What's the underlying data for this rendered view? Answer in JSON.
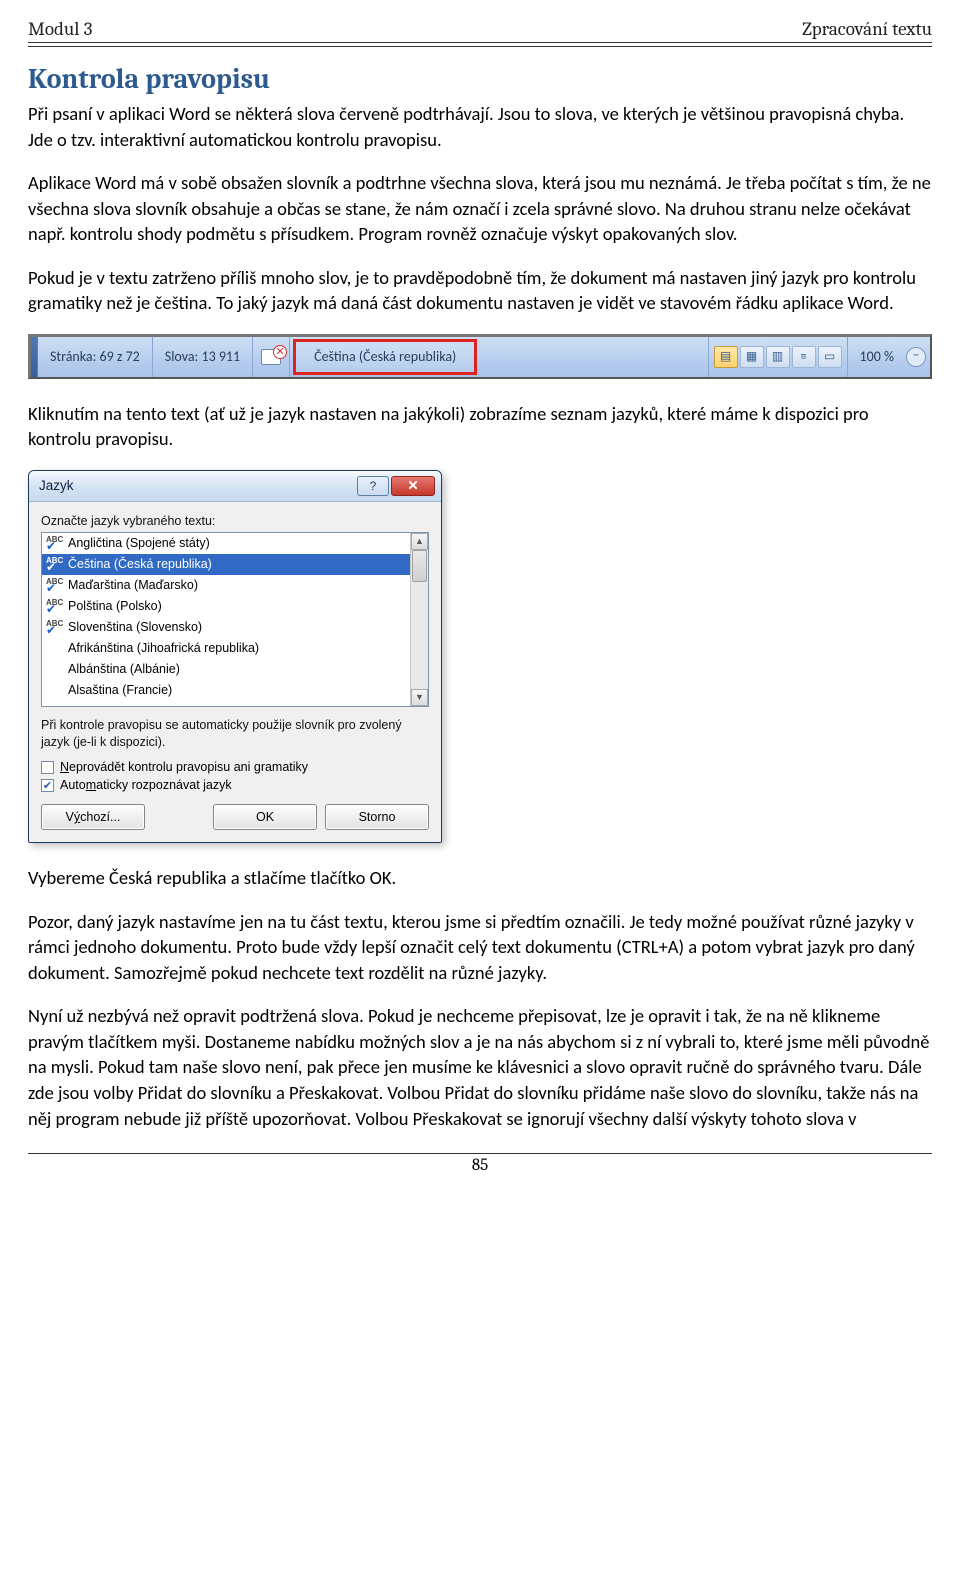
{
  "header": {
    "left": "Modul 3",
    "right": "Zpracování textu"
  },
  "title": "Kontrola pravopisu",
  "para1": "Při psaní v aplikaci Word se některá slova červeně podtrhávají. Jsou to slova, ve kterých je většinou pravopisná chyba. Jde o tzv. interaktivní automatickou kontrolu pravopisu.",
  "para2": "Aplikace Word má v sobě obsažen slovník a podtrhne všechna slova, která jsou mu neznámá. Je třeba počítat s tím, že ne všechna slova slovník obsahuje a občas se stane, že nám označí i zcela správné slovo. Na druhou stranu nelze očekávat např. kontrolu shody podmětu s přísudkem. Program rovněž označuje výskyt opakovaných slov.",
  "para3": "Pokud je v textu zatrženo příliš mnoho slov, je to pravděpodobně tím, že dokument má nastaven jiný jazyk pro kontrolu gramatiky než je čeština. To jaký jazyk má daná část dokumentu nastaven je vidět ve stavovém řádku aplikace Word.",
  "statusbar": {
    "page": "Stránka: 69 z 72",
    "words": "Slova: 13 911",
    "lang": "Čeština (Česká republika)",
    "zoom": "100 %"
  },
  "para4": "Kliknutím na tento text (ať už je jazyk nastaven na jakýkoli) zobrazíme seznam jazyků, které máme k dispozici pro kontrolu pravopisu.",
  "dialog": {
    "title": "Jazyk",
    "label": "Označte jazyk vybraného textu:",
    "items": [
      {
        "text": "Angličtina (Spojené státy)",
        "spellcheck": true,
        "selected": false
      },
      {
        "text": "Čeština (Česká republika)",
        "spellcheck": true,
        "selected": true
      },
      {
        "text": "Maďarština (Maďarsko)",
        "spellcheck": true,
        "selected": false
      },
      {
        "text": "Polština (Polsko)",
        "spellcheck": true,
        "selected": false
      },
      {
        "text": "Slovenština (Slovensko)",
        "spellcheck": true,
        "selected": false
      },
      {
        "text": "Afrikánština (Jihoafrická republika)",
        "spellcheck": false,
        "selected": false
      },
      {
        "text": "Albánština (Albánie)",
        "spellcheck": false,
        "selected": false
      },
      {
        "text": "Alsaština (Francie)",
        "spellcheck": false,
        "selected": false
      }
    ],
    "desc": "Při kontrole pravopisu se automaticky použije slovník pro zvolený jazyk (je-li k dispozici).",
    "check1": "Neprovádět kontrolu pravopisu ani gramatiky",
    "check2": "Automaticky rozpoznávat jazyk",
    "btn_default_pre": "V",
    "btn_default_u": "ý",
    "btn_default_post": "chozí...",
    "btn_ok": "OK",
    "btn_cancel": "Storno"
  },
  "para5": "Vybereme Česká republika a stlačíme tlačítko OK.",
  "para6": "Pozor, daný jazyk nastavíme jen na tu část textu, kterou jsme si předtím označili. Je tedy možné používat různé jazyky v rámci jednoho dokumentu. Proto bude vždy lepší označit celý text dokumentu (CTRL+A) a potom vybrat jazyk pro daný dokument. Samozřejmě pokud nechcete text rozdělit na různé jazyky.",
  "para7": "Nyní už nezbývá než opravit podtržená slova. Pokud je nechceme přepisovat, lze je opravit i tak, že na ně klikneme pravým tlačítkem myši. Dostaneme nabídku možných slov a je na nás abychom si z ní vybrali to, které jsme měli původně na mysli. Pokud tam naše slovo není, pak přece jen musíme ke klávesnici a slovo opravit ručně do správného tvaru. Dále zde jsou volby Přidat do slovníku a Přeskakovat. Volbou Přidat do slovníku přidáme naše slovo do slovníku, takže nás na něj program nebude již příště upozorňovat. Volbou Přeskakovat se ignorují všechny další výskyty tohoto slova v",
  "page_number": "85"
}
